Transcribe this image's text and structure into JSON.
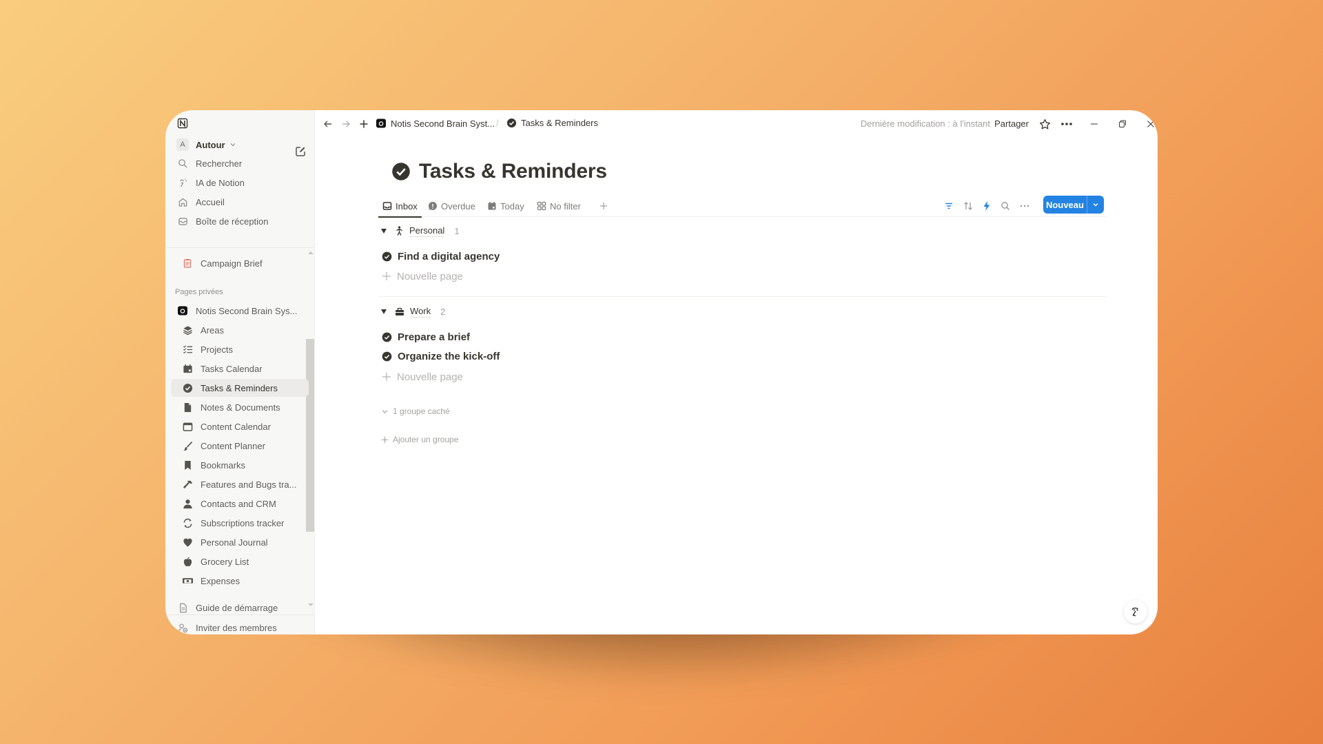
{
  "sidebar": {
    "workspace": {
      "avatar": "A",
      "name": "Autour"
    },
    "top_items": [
      {
        "icon": "search-icon",
        "label": "Rechercher"
      },
      {
        "icon": "notion-ai-icon",
        "label": "IA de Notion"
      },
      {
        "icon": "home-icon",
        "label": "Accueil"
      },
      {
        "icon": "inbox-icon",
        "label": "Boîte de réception"
      }
    ],
    "pinned": {
      "icon": "clipboard-icon",
      "label": "Campaign Brief"
    },
    "section_label": "Pages privées",
    "root_page": {
      "icon": "camera-icon",
      "label": "Notis Second Brain Sys..."
    },
    "pages": [
      {
        "icon": "layers-icon",
        "label": "Areas"
      },
      {
        "icon": "checklist-icon",
        "label": "Projects"
      },
      {
        "icon": "calendar-filled-icon",
        "label": "Tasks Calendar"
      },
      {
        "icon": "check-circle-icon",
        "label": "Tasks & Reminders",
        "active": true
      },
      {
        "icon": "document-icon",
        "label": "Notes & Documents"
      },
      {
        "icon": "calendar-icon",
        "label": "Content Calendar"
      },
      {
        "icon": "brush-icon",
        "label": "Content Planner"
      },
      {
        "icon": "bookmark-icon",
        "label": "Bookmarks"
      },
      {
        "icon": "hammer-icon",
        "label": "Features and Bugs tra..."
      },
      {
        "icon": "person-icon",
        "label": "Contacts and CRM"
      },
      {
        "icon": "refresh-icon",
        "label": "Subscriptions tracker"
      },
      {
        "icon": "heart-icon",
        "label": "Personal Journal"
      },
      {
        "icon": "apple-icon",
        "label": "Grocery List"
      },
      {
        "icon": "money-icon",
        "label": "Expenses"
      }
    ],
    "guide": {
      "icon": "page-icon",
      "label": "Guide de démarrage"
    },
    "invite": {
      "icon": "invite-icon",
      "label": "Inviter des membres"
    }
  },
  "topbar": {
    "breadcrumb": [
      {
        "icon": "camera-icon",
        "label": "Notis Second Brain Syst..."
      },
      {
        "icon": "check-circle-icon",
        "label": "Tasks & Reminders"
      }
    ],
    "separator": "/",
    "last_edit": "Dernière modification : à l'instant",
    "share_label": "Partager"
  },
  "page": {
    "title": "Tasks & Reminders",
    "tabs": [
      {
        "icon": "inbox-icon",
        "label": "Inbox",
        "active": true
      },
      {
        "icon": "alert-bubble-icon",
        "label": "Overdue"
      },
      {
        "icon": "calendar-filled-icon",
        "label": "Today"
      },
      {
        "icon": "grid-icon",
        "label": "No filter"
      }
    ],
    "new_button": "Nouveau",
    "accent": "#2383e2",
    "groups": [
      {
        "icon": "walking-person-icon",
        "name": "Personal",
        "count": "1",
        "tasks": [
          "Find a digital agency"
        ],
        "new_label": "Nouvelle page"
      },
      {
        "icon": "briefcase-icon",
        "name": "Work",
        "count": "2",
        "tasks": [
          "Prepare a brief",
          "Organize the kick-off"
        ],
        "new_label": "Nouvelle page"
      }
    ],
    "hidden_groups": "1 groupe caché",
    "add_group": "Ajouter un groupe"
  }
}
